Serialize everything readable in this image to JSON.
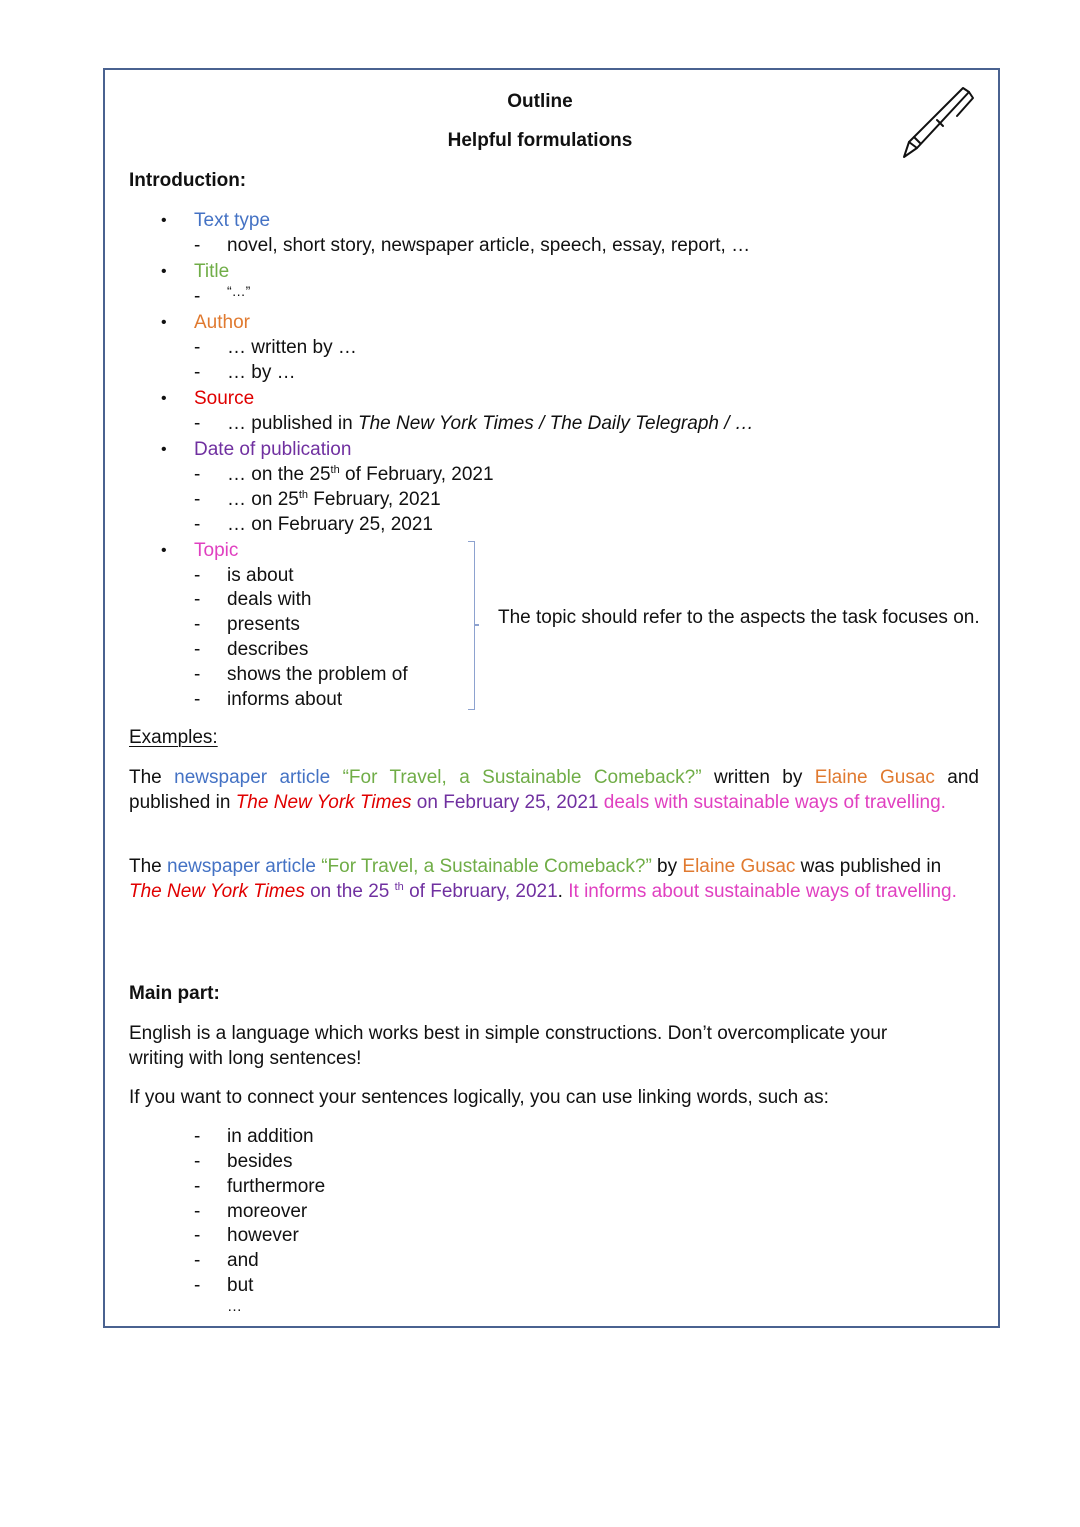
{
  "header": {
    "title": "Outline",
    "subtitle": "Helpful formulations",
    "decoration_icon": "pen-icon"
  },
  "colors": {
    "text_type": "#4472c4",
    "title": "#70ad47",
    "author": "#e07a30",
    "source": "#e00000",
    "date": "#7030a0",
    "topic": "#e040c0",
    "frame_border": "#4a6290"
  },
  "introduction": {
    "heading": "Introduction:",
    "bullet_glyph": "•",
    "dash_glyph": "-",
    "sections": [
      {
        "label": "Text type",
        "items": [
          "novel, short story, newspaper article, speech, essay, report, …"
        ]
      },
      {
        "label": "Title",
        "items": [
          "“…”"
        ]
      },
      {
        "label": "Author",
        "items": [
          "… written by …",
          "… by …"
        ]
      },
      {
        "label": "Source",
        "items": [
          {
            "prefix": "… published in ",
            "italic": "The New York Times / The Daily Telegraph / …"
          }
        ]
      },
      {
        "label": "Date of publication",
        "items": [
          {
            "a": "… on the 25",
            "sup": "th",
            "b": " of February, 2021"
          },
          {
            "a": "… on 25",
            "sup": "th",
            "b": " February, 2021"
          },
          "… on February 25, 2021"
        ]
      },
      {
        "label": "Topic",
        "items": [
          "is about",
          "deals with",
          "presents",
          "describes",
          "shows the problem of",
          "informs about"
        ]
      }
    ],
    "topic_note": "The topic should refer to the aspects the task focuses on."
  },
  "examples": {
    "heading": "Examples:",
    "example1": {
      "the": "The ",
      "text_type": "newspaper article",
      "title": " “For Travel, a Sustainable Comeback?”",
      "written_by": " written by ",
      "author": "Elaine Gusac",
      "and_published_in": " and published in ",
      "source": "The New York Times",
      "date": " on February 25, 2021",
      "topic": " deals with sustainable ways of travelling."
    },
    "example2": {
      "the": "The ",
      "text_type": "newspaper article",
      "title": " “For Travel, a Sustainable Comeback?”",
      "by": " by ",
      "author": "Elaine Gusac",
      "was_published_in": " was published in ",
      "source": "The New York Times",
      "date_a": " on the 25 ",
      "date_sup": "th",
      "date_b": " of February, 2021",
      "period": ".",
      "topic": " It informs about sustainable ways of travelling."
    }
  },
  "main_part": {
    "heading": "Main part:",
    "paragraph1": "English is a language which works best in simple constructions. Don’t overcomplicate your writing with long sentences!",
    "paragraph2": "If you want to connect your sentences logically, you can use linking words, such as:",
    "linking_words": [
      "in addition",
      "besides",
      "furthermore",
      "moreover",
      "however",
      "and",
      "but"
    ],
    "ellipsis": "…"
  }
}
